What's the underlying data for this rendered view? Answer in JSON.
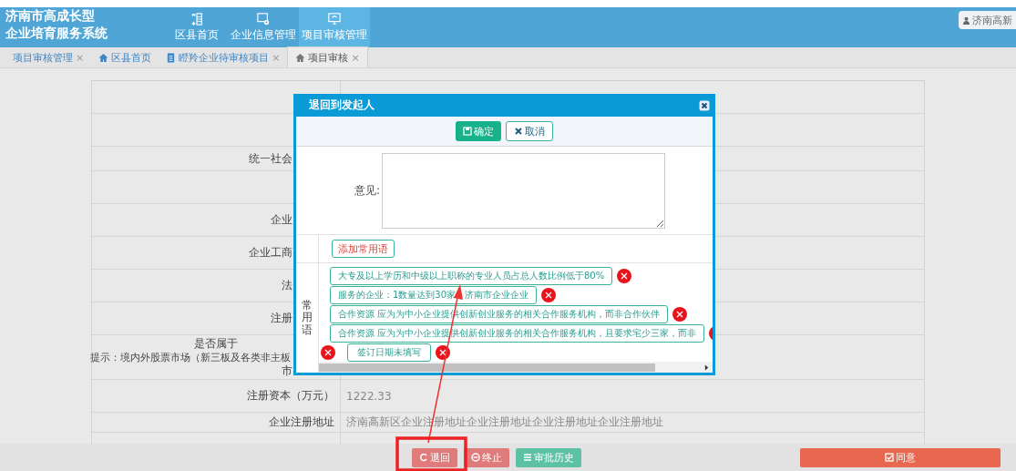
{
  "header": {
    "logo_lines": [
      "济南市高成长型",
      "企业培育服务系统"
    ],
    "nav": [
      {
        "label": "区县首页",
        "selected": false
      },
      {
        "label": "企业信息管理",
        "selected": false
      },
      {
        "label": "项目审核管理",
        "selected": true
      }
    ],
    "user": "济南高新"
  },
  "tabs": [
    {
      "label": "项目审核管理",
      "close": "×",
      "selected": false
    },
    {
      "label": "区县首页",
      "selected": false
    },
    {
      "label": "瞪羚企业待审核项目",
      "close": "×",
      "selected": false
    },
    {
      "label": "项目审核",
      "close": "×",
      "selected": true
    }
  ],
  "table": {
    "rows": [
      {
        "label": []
      },
      {
        "label": []
      },
      {
        "label": [
          "统一社会"
        ]
      },
      {
        "label": []
      },
      {
        "label": [
          "企业"
        ]
      },
      {
        "label": [
          "企业工商"
        ]
      },
      {
        "label": [
          "法"
        ]
      },
      {
        "label": [
          "注册"
        ]
      },
      {
        "label": [
          "是否属于",
          "提示：境内外股票市场（新三板及各类非主板",
          "市"
        ]
      },
      {
        "label": [
          "注册资本（万元）"
        ],
        "value": "1222.33"
      },
      {
        "label": [
          "企业注册地址"
        ],
        "value": "济南高新区企业注册地址企业注册地址企业注册地址企业注册地址"
      },
      {
        "label": []
      }
    ]
  },
  "dialog": {
    "title": "退回到发起人",
    "confirm": "确定",
    "cancel": "取消",
    "opinion_label": "意见:",
    "add_phrase": "添加常用语",
    "phrases_label": "常用语",
    "phrases": [
      "大专及以上学历和中级以上职称的专业人员占总人数比例低于80%",
      "服务的企业：1数量达到30家，济南市企业企业",
      "合作资源 应为为中小企业提供创新创业服务的相关合作服务机构，而非合作伙伴",
      "合作资源 应为为中小企业提供创新创业服务的相关合作服务机构，且要求宅少三家，而非",
      "签订日期未填写"
    ]
  },
  "actions": [
    {
      "label": "退回",
      "kind": "return"
    },
    {
      "label": "终止",
      "kind": "stop"
    },
    {
      "label": "审批历史",
      "kind": "history"
    },
    {
      "label": "同意",
      "kind": "agree"
    }
  ]
}
